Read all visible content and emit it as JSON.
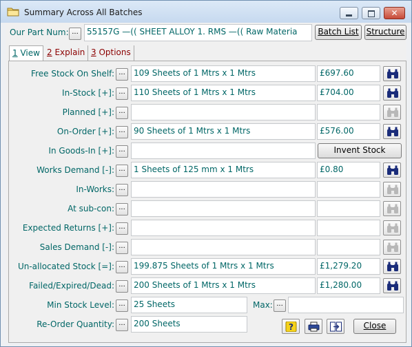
{
  "window": {
    "title": "Summary Across All Batches",
    "icon": "folder-icon"
  },
  "header": {
    "part_num_label": "Our Part Num:",
    "part_num_value": "55157G    —(( SHEET ALLOY 1.  RMS    —(( Raw Materia",
    "batch_list_label": "Batch List",
    "structure_label": "Structure"
  },
  "tabs": [
    {
      "num": "1",
      "label": " View"
    },
    {
      "num": "2",
      "label": " Explain"
    },
    {
      "num": "3",
      "label": " Options"
    }
  ],
  "rows": [
    {
      "label": "Free Stock On Shelf:",
      "qty": "109 Sheets of 1 Mtrs x 1 Mtrs",
      "value": "£697.60",
      "enabled": true
    },
    {
      "label": "In-Stock [+]:",
      "qty": "110 Sheets of 1 Mtrs x 1 Mtrs",
      "value": "£704.00",
      "enabled": true
    },
    {
      "label": "Planned [+]:",
      "qty": "",
      "value": "",
      "enabled": false
    },
    {
      "label": "On-Order [+]:",
      "qty": "90 Sheets of 1 Mtrs x 1 Mtrs",
      "value": "£576.00",
      "enabled": true
    },
    {
      "label": "In Goods-In [+]:",
      "qty": "",
      "value": "",
      "enabled": false
    },
    {
      "label": "Works Demand [-]:",
      "qty": "1 Sheets of 125 mm x 1 Mtrs",
      "value": "£0.80",
      "enabled": true
    },
    {
      "label": "In-Works:",
      "qty": "",
      "value": "",
      "enabled": false
    },
    {
      "label": "At sub-con:",
      "qty": "",
      "value": "",
      "enabled": false
    },
    {
      "label": "Expected Returns [+]:",
      "qty": "",
      "value": "",
      "enabled": false
    },
    {
      "label": "Sales Demand [-]:",
      "qty": "",
      "value": "",
      "enabled": false
    },
    {
      "label": "Un-allocated Stock [=]:",
      "qty": "199.875 Sheets of 1 Mtrs x 1 Mtrs",
      "value": "£1,279.20",
      "enabled": true
    },
    {
      "label": "Failed/Expired/Dead:",
      "qty": "200 Sheets of 1 Mtrs x 1 Mtrs",
      "value": "£1,280.00",
      "enabled": true
    }
  ],
  "invent_stock_label": "Invent Stock",
  "min_stock": {
    "label": "Min Stock Level:",
    "value": "25 Sheets"
  },
  "max": {
    "label": "Max:",
    "value": ""
  },
  "reorder": {
    "label": "Re-Order Quantity:",
    "value": "200 Sheets"
  },
  "dots_label": "...",
  "close_label": "Close",
  "colors": {
    "label_teal": "#006666",
    "tab_red": "#8b0000",
    "binocular_blue": "#1a2c7a"
  }
}
